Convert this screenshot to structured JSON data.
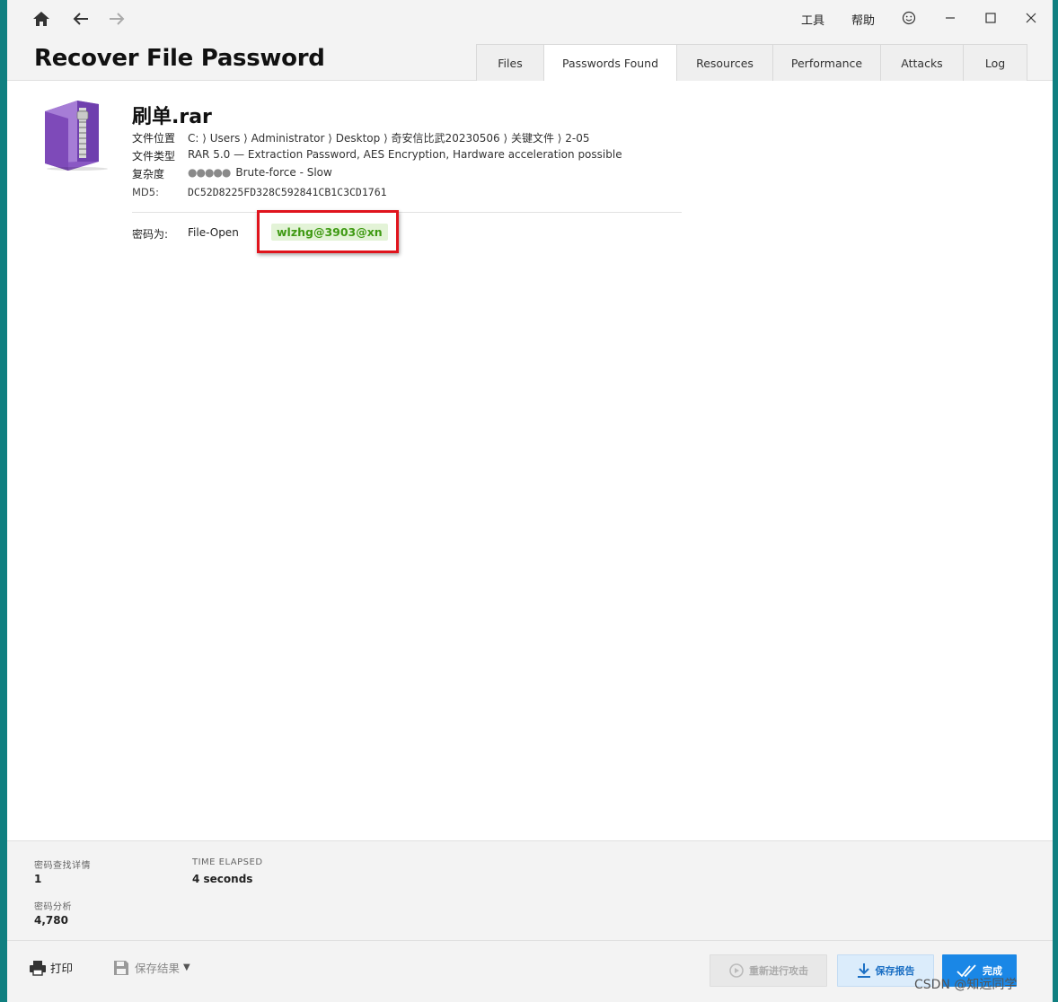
{
  "header": {
    "title": "Recover File Password",
    "menu": {
      "tools": "工具",
      "help": "帮助"
    },
    "tabs": [
      {
        "label": "Files",
        "active": false
      },
      {
        "label": "Passwords Found",
        "active": true
      },
      {
        "label": "Resources",
        "active": false
      },
      {
        "label": "Performance",
        "active": false
      },
      {
        "label": "Attacks",
        "active": false
      },
      {
        "label": "Log",
        "active": false
      }
    ]
  },
  "file": {
    "name": "刷单.rar",
    "icon": "winrar-archive-icon",
    "location_label": "文件位置",
    "location": "C: ⟩ Users ⟩ Administrator ⟩ Desktop ⟩ 奇安信比武20230506 ⟩ 关键文件 ⟩ 2-05",
    "type_label": "文件类型",
    "type": "RAR 5.0 — Extraction Password, AES Encryption, Hardware acceleration possible",
    "complexity_label": "复杂度",
    "complexity_dots": "●●●●●",
    "complexity": "Brute-force - Slow",
    "md5_label": "MD5:",
    "md5": "DC52D8225FD328C592841CB1C3CD1761"
  },
  "password": {
    "label": "密码为:",
    "type": "File-Open",
    "value": "wlzhg@3903@xn"
  },
  "stats": {
    "found_label": "密码查找详情",
    "found_value": "1",
    "elapsed_label": "TIME ELAPSED",
    "elapsed_value": "4 seconds",
    "analysis_label": "密码分析",
    "analysis_value": "4,780"
  },
  "footer": {
    "print": "打印",
    "save_results": "保存结果",
    "rerun": "重新进行攻击",
    "save_report": "保存报告",
    "done": "完成"
  },
  "watermark": "CSDN @知远同学",
  "colors": {
    "accent": "#1a87e6",
    "password_text": "#3f9a13",
    "password_bg": "#e3f3d7",
    "highlight_box": "#e0141d",
    "desktop": "#0f7f80"
  }
}
